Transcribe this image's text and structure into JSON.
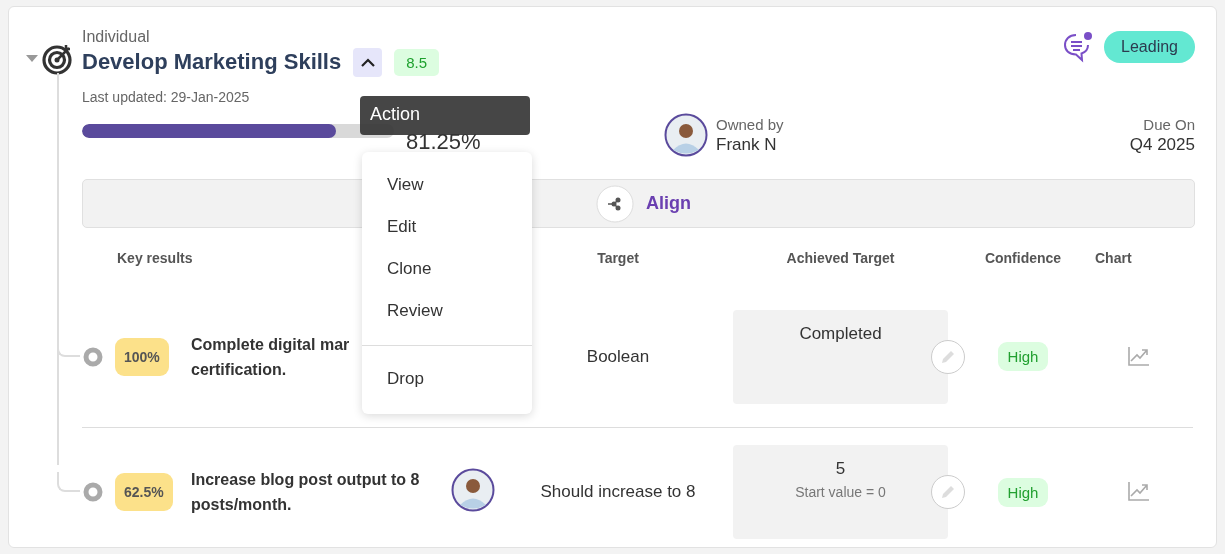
{
  "objective": {
    "type": "Individual",
    "title": "Develop Marketing Skills",
    "expanded": true,
    "score": "8.5",
    "has_notification": true,
    "status": "Leading",
    "last_updated": "Last updated: 29-Jan-2025",
    "progress": {
      "level": 0.8125,
      "reading": "81.25%"
    },
    "owner": {
      "label": "Owned by",
      "name": "Frank N"
    },
    "due": {
      "label": "Due On",
      "value": "Q4 2025"
    },
    "align_label": "Align"
  },
  "key_results": {
    "columns": [
      "Key results",
      "Target",
      "Achieved Target",
      "Confidence",
      "Chart"
    ],
    "rows": [
      {
        "progress": "100%",
        "title": "Complete digital mar\ncertification.",
        "target": "Boolean",
        "achieved": {
          "value": "Completed"
        },
        "confidence": "High"
      },
      {
        "progress": "62.5%",
        "title": "Increase blog post output to 8\nposts/month.",
        "avatar": true,
        "target": "Should increase to 8",
        "achieved": {
          "value": "5",
          "note": "Start value = 0"
        },
        "confidence": "High"
      }
    ]
  },
  "tooltip": "Action",
  "menu": [
    {
      "label": "View",
      "kind": "item"
    },
    {
      "label": "Edit",
      "kind": "item"
    },
    {
      "label": "Clone",
      "kind": "item"
    },
    {
      "label": "Review",
      "kind": "item"
    },
    {
      "label": "Drop",
      "kind": "separated"
    }
  ]
}
